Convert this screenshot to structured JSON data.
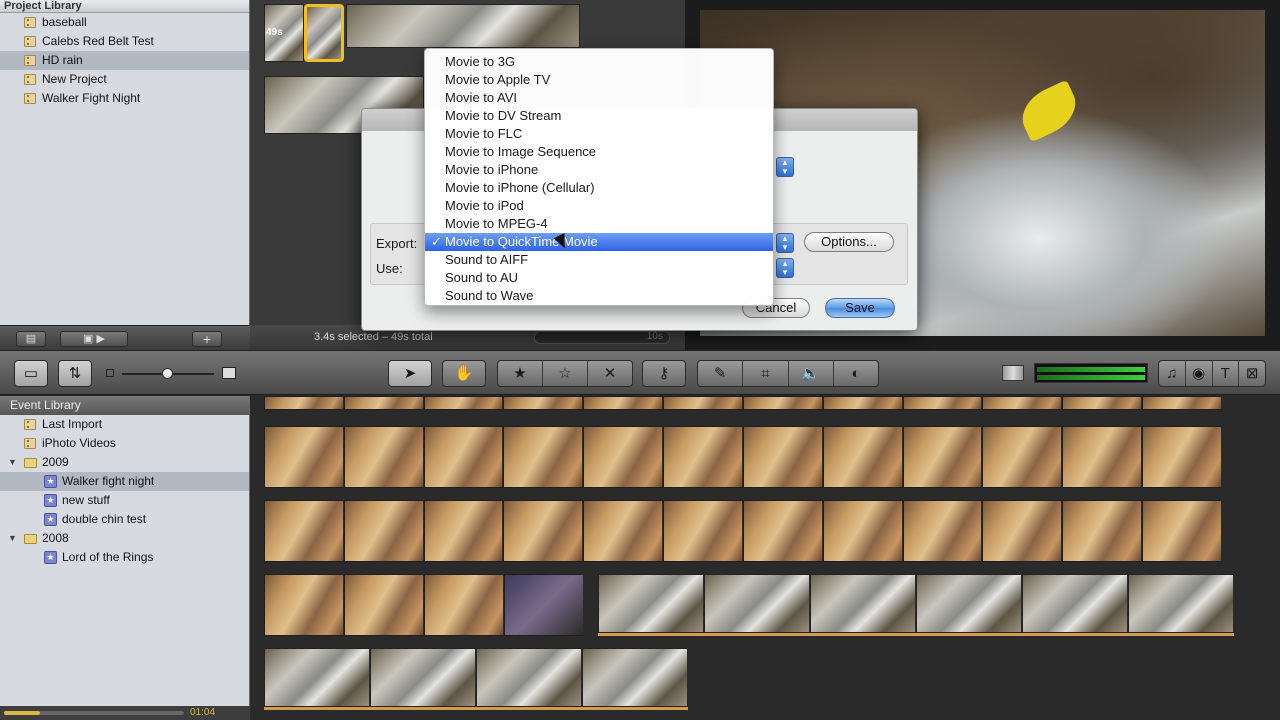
{
  "project_library": {
    "title": "Project Library",
    "items": [
      {
        "label": "baseball"
      },
      {
        "label": "Calebs Red Belt Test"
      },
      {
        "label": "HD rain"
      },
      {
        "label": "New Project"
      },
      {
        "label": "Walker Fight Night"
      }
    ],
    "selected_index": 2
  },
  "project_clip": {
    "duration": "49s"
  },
  "status": {
    "selection": "3.4s selected – 49s total",
    "zoom": "10s"
  },
  "toolbar": {
    "icons": [
      "camera-icon",
      "swap-icon",
      "small-thumb-icon",
      "large-thumb-icon",
      "arrow-icon",
      "hand-icon",
      "star-icon",
      "star-outline-icon",
      "x-icon",
      "key-icon",
      "eyedropper-icon",
      "crop-icon",
      "audio-icon",
      "adjust-icon",
      "audio-meter-icon",
      "music-icon",
      "photo-icon",
      "title-icon",
      "transition-icon"
    ],
    "labels": {
      "title_button": "T"
    }
  },
  "event_library": {
    "title": "Event Library",
    "items": [
      {
        "label": "Last Import",
        "type": "film"
      },
      {
        "label": "iPhoto Videos",
        "type": "film"
      },
      {
        "label": "2009",
        "type": "year"
      },
      {
        "label": "Walker fight night",
        "type": "event"
      },
      {
        "label": "new stuff",
        "type": "event"
      },
      {
        "label": "double chin test",
        "type": "event"
      },
      {
        "label": "2008",
        "type": "year"
      },
      {
        "label": "Lord of the Rings",
        "type": "event"
      }
    ],
    "playback_time": "01:04"
  },
  "dialog": {
    "export_label": "Export:",
    "use_label": "Use:",
    "options_button": "Options...",
    "cancel_button": "Cancel",
    "save_button": "Save"
  },
  "export_menu": {
    "items": [
      "Movie to 3G",
      "Movie to Apple TV",
      "Movie to AVI",
      "Movie to DV Stream",
      "Movie to FLC",
      "Movie to Image Sequence",
      "Movie to iPhone",
      "Movie to iPhone (Cellular)",
      "Movie to iPod",
      "Movie to MPEG-4",
      "Movie to QuickTime Movie",
      "Sound to AIFF",
      "Sound to AU",
      "Sound to Wave"
    ],
    "selected": "Movie to QuickTime Movie",
    "check": "✓"
  },
  "colors": {
    "selection_blue": "#2d63e6",
    "leaf_yellow": "#e6d21c",
    "clip_highlight": "#f0c020"
  }
}
